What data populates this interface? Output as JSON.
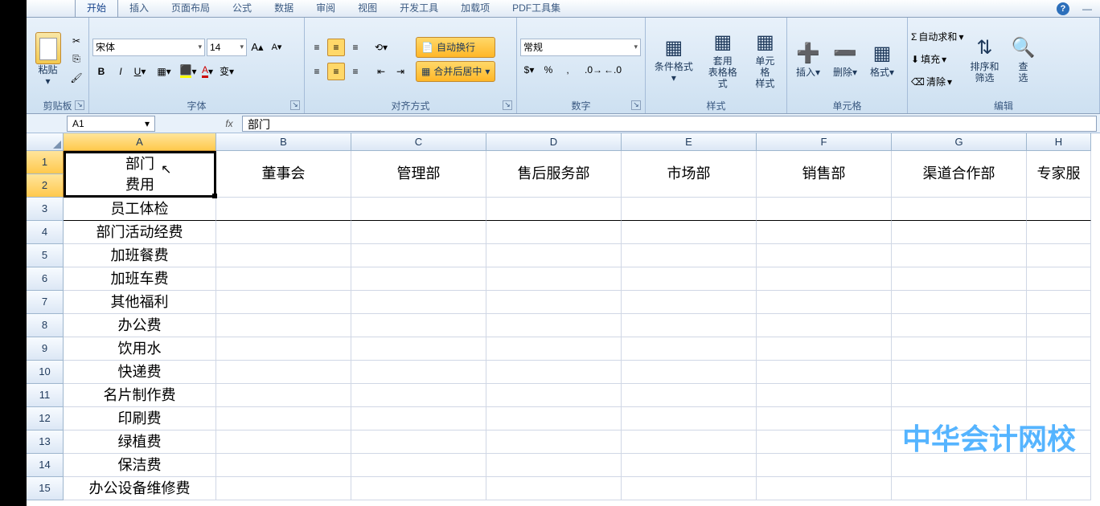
{
  "tabs": [
    "开始",
    "插入",
    "页面布局",
    "公式",
    "数据",
    "审阅",
    "视图",
    "开发工具",
    "加载项",
    "PDF工具集"
  ],
  "active_tab": 0,
  "clipboard": {
    "paste": "粘贴",
    "label": "剪贴板"
  },
  "font": {
    "name": "宋体",
    "size": "14",
    "label": "字体"
  },
  "alignment": {
    "wrap": "自动换行",
    "merge": "合并后居中",
    "label": "对齐方式"
  },
  "number": {
    "format": "常规",
    "label": "数字"
  },
  "styles": {
    "cond": "条件格式",
    "table": "套用\n表格格式",
    "cell": "单元格\n样式",
    "label": "样式"
  },
  "cells": {
    "insert": "插入",
    "delete": "删除",
    "format": "格式",
    "label": "单元格"
  },
  "editing": {
    "sum": "自动求和",
    "fill": "填充",
    "clear": "清除",
    "sort": "排序和\n筛选",
    "find": "查\n选",
    "label": "编辑"
  },
  "name_box": "A1",
  "formula_value": "部门",
  "columns": [
    "A",
    "B",
    "C",
    "D",
    "E",
    "F",
    "G",
    "H"
  ],
  "merged_lines": [
    "部门",
    "费用"
  ],
  "header_row": [
    "",
    "董事会",
    "管理部",
    "售后服务部",
    "市场部",
    "销售部",
    "渠道合作部",
    "专家服"
  ],
  "rows": [
    {
      "n": 3,
      "a": "员工体检"
    },
    {
      "n": 4,
      "a": "部门活动经费"
    },
    {
      "n": 5,
      "a": "加班餐费"
    },
    {
      "n": 6,
      "a": "加班车费"
    },
    {
      "n": 7,
      "a": "其他福利"
    },
    {
      "n": 8,
      "a": "办公费"
    },
    {
      "n": 9,
      "a": "饮用水"
    },
    {
      "n": 10,
      "a": "快递费"
    },
    {
      "n": 11,
      "a": "名片制作费"
    },
    {
      "n": 12,
      "a": "印刷费"
    },
    {
      "n": 13,
      "a": "绿植费"
    },
    {
      "n": 14,
      "a": "保洁费"
    },
    {
      "n": 15,
      "a": "办公设备维修费"
    }
  ],
  "watermark": "中华会计网校"
}
